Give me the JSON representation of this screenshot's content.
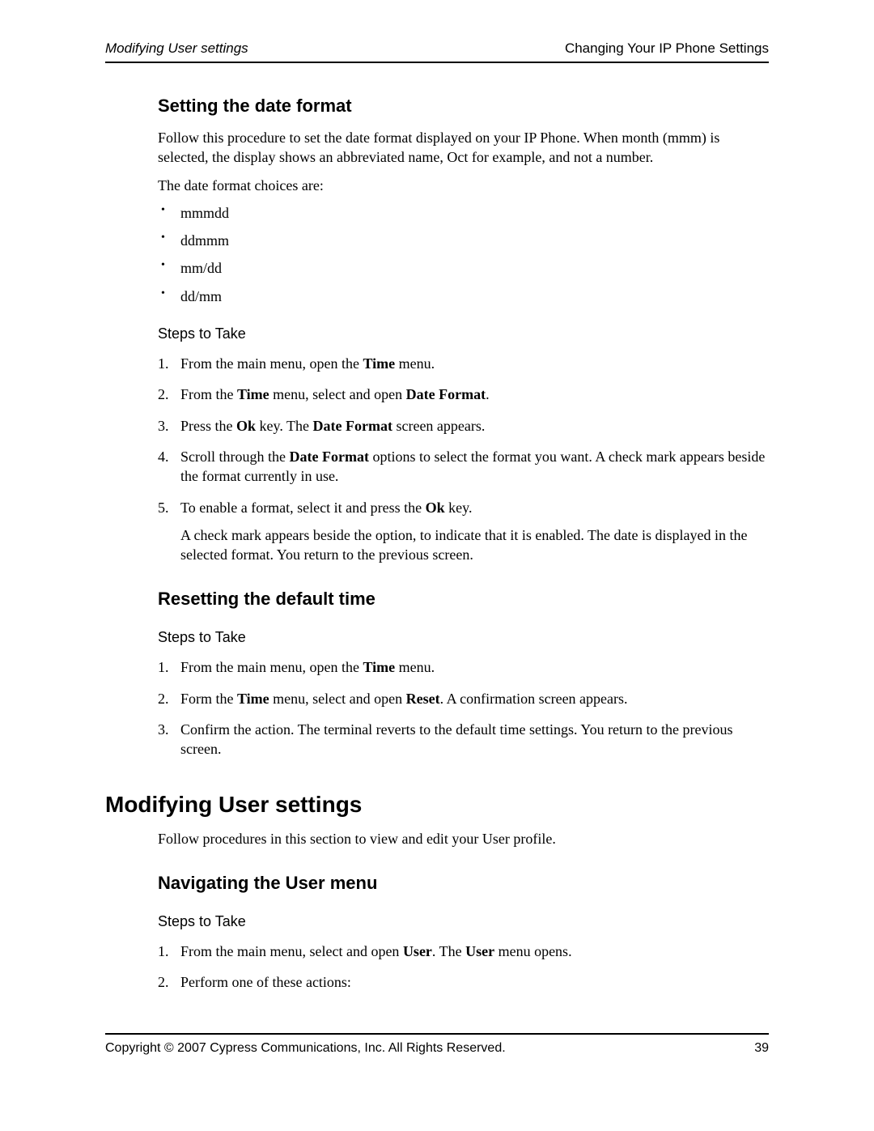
{
  "header": {
    "left": "Modifying User settings",
    "right": "Changing Your IP Phone Settings"
  },
  "section1": {
    "title": "Setting the date format",
    "intro": "Follow this procedure to set the date format displayed on your IP Phone. When month (mmm) is selected, the display shows an abbreviated name, Oct for example, and not a number.",
    "choices_intro": "The date format choices are:",
    "choices": [
      "mmmdd",
      "ddmmm",
      "mm/dd",
      "dd/mm"
    ],
    "steps_label": "Steps to Take",
    "steps": [
      [
        {
          "t": "From the main menu, open the "
        },
        {
          "t": "Time",
          "b": true
        },
        {
          "t": " menu."
        }
      ],
      [
        {
          "t": "From the "
        },
        {
          "t": "Time",
          "b": true
        },
        {
          "t": " menu, select and open "
        },
        {
          "t": "Date Format",
          "b": true
        },
        {
          "t": "."
        }
      ],
      [
        {
          "t": "Press the "
        },
        {
          "t": "Ok",
          "b": true
        },
        {
          "t": " key. The "
        },
        {
          "t": "Date Format",
          "b": true
        },
        {
          "t": " screen appears."
        }
      ],
      [
        {
          "t": "Scroll through the "
        },
        {
          "t": "Date Format",
          "b": true
        },
        {
          "t": " options to select the format you want. A check mark appears beside the format currently in use."
        }
      ],
      [
        {
          "t": "To enable a format, select it and press the "
        },
        {
          "t": "Ok",
          "b": true
        },
        {
          "t": " key."
        }
      ]
    ],
    "step5_sub": "A check mark appears beside the option, to indicate that it is enabled. The date is displayed in the selected format. You return to the previous screen."
  },
  "section2": {
    "title": "Resetting the default time",
    "steps_label": "Steps to Take",
    "steps": [
      [
        {
          "t": "From the main menu, open the "
        },
        {
          "t": "Time",
          "b": true
        },
        {
          "t": " menu."
        }
      ],
      [
        {
          "t": "Form the "
        },
        {
          "t": "Time",
          "b": true
        },
        {
          "t": " menu, select and open "
        },
        {
          "t": "Reset",
          "b": true
        },
        {
          "t": ". A confirmation screen appears."
        }
      ],
      [
        {
          "t": "Confirm the action. The terminal reverts to the default time settings. You return to the previous screen."
        }
      ]
    ]
  },
  "major": {
    "title": "Modifying User settings",
    "intro": "Follow procedures in this section to view and edit your User profile."
  },
  "section3": {
    "title": "Navigating the User menu",
    "steps_label": "Steps to Take",
    "steps": [
      [
        {
          "t": "From the main menu, select and open "
        },
        {
          "t": "User",
          "b": true
        },
        {
          "t": ". The "
        },
        {
          "t": "User",
          "b": true
        },
        {
          "t": " menu opens."
        }
      ],
      [
        {
          "t": "Perform one of these actions:"
        }
      ]
    ]
  },
  "footer": {
    "left": "Copyright © 2007 Cypress Communications, Inc. All Rights Reserved.",
    "right": "39"
  }
}
